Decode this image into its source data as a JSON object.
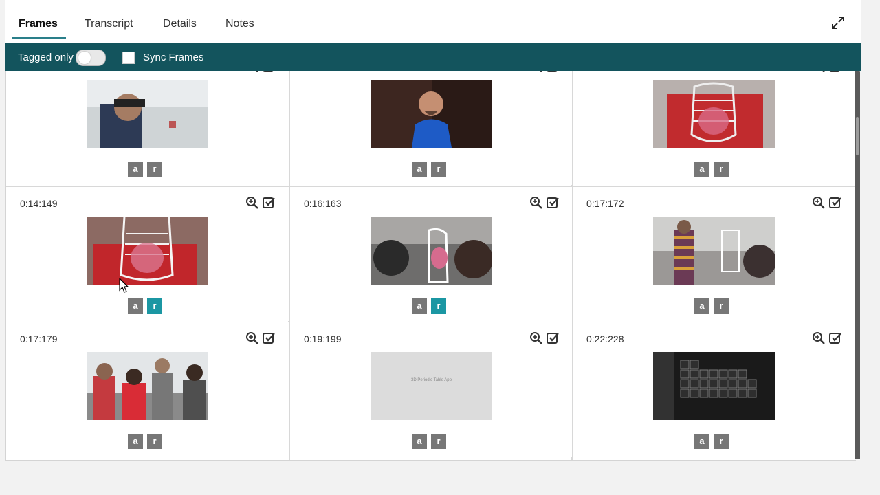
{
  "tabs": [
    {
      "label": "Frames",
      "active": true
    },
    {
      "label": "Transcript",
      "active": false
    },
    {
      "label": "Details",
      "active": false
    },
    {
      "label": "Notes",
      "active": false
    }
  ],
  "toolbar": {
    "tagged_only_label": "Tagged only",
    "tagged_only_on": false,
    "sync_frames_label": "Sync Frames",
    "sync_frames_checked": false
  },
  "colors": {
    "toolbar_bg": "#13545d",
    "tag_default": "#777777",
    "tag_active": "#1b97a3"
  },
  "frames": [
    {
      "time": "",
      "a_active": false,
      "r_active": false,
      "thumb": "man-with-headset-indoors"
    },
    {
      "time": "",
      "a_active": false,
      "r_active": false,
      "thumb": "bald-man-blue-shirt"
    },
    {
      "time": "",
      "a_active": false,
      "r_active": false,
      "thumb": "hologram-anatomy-ribcage"
    },
    {
      "time": "0:14:149",
      "a_active": false,
      "r_active": true,
      "thumb": "hologram-anatomy-person"
    },
    {
      "time": "0:16:163",
      "a_active": false,
      "r_active": true,
      "thumb": "people-with-hololens-hologram"
    },
    {
      "time": "0:17:172",
      "a_active": false,
      "r_active": false,
      "thumb": "group-hologram-striped-sweater"
    },
    {
      "time": "0:17:179",
      "a_active": false,
      "r_active": false,
      "thumb": "group-of-students"
    },
    {
      "time": "0:19:199",
      "a_active": false,
      "r_active": false,
      "thumb": "title-card",
      "thumb_text": "3D Periodic Table App"
    },
    {
      "time": "0:22:228",
      "a_active": false,
      "r_active": false,
      "thumb": "periodic-table-dark"
    }
  ],
  "tag_labels": {
    "a": "a",
    "r": "r"
  }
}
